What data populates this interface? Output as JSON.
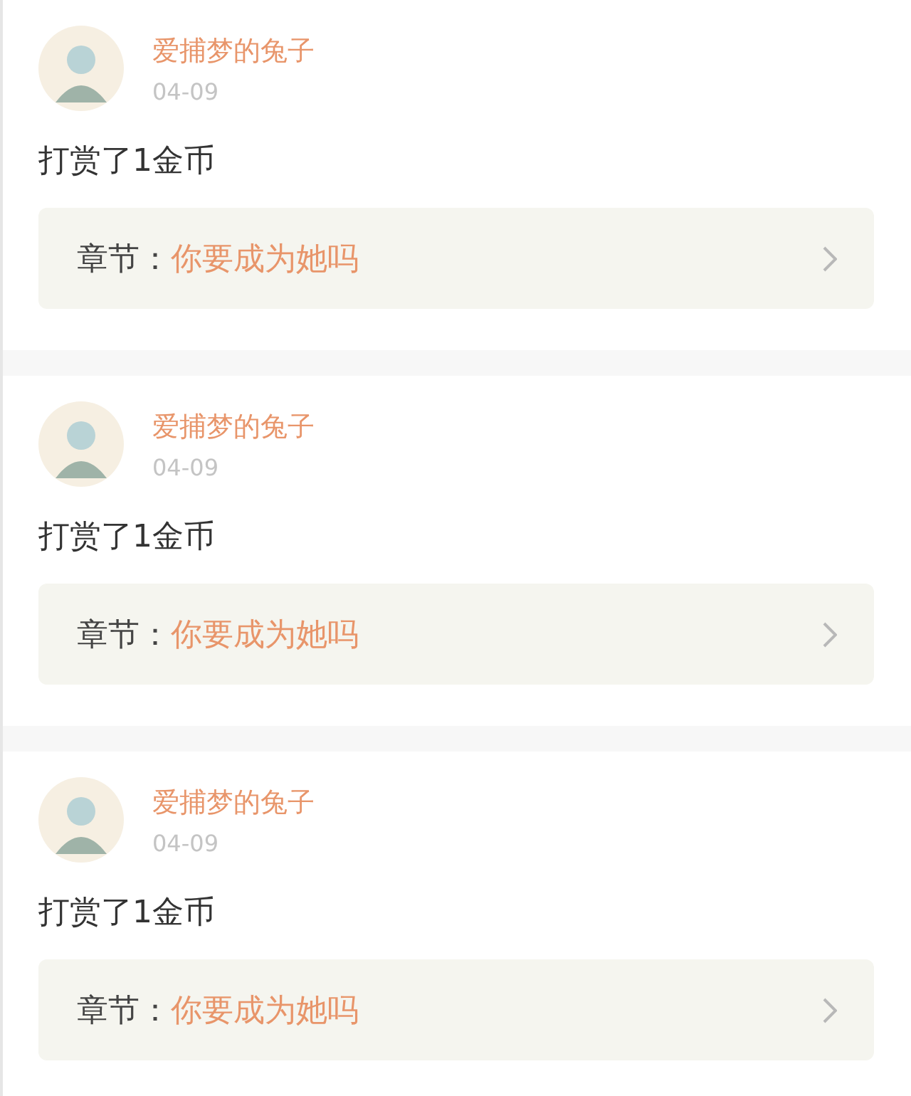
{
  "entries": [
    {
      "user": "爱捕梦的兔子",
      "date": "04-09",
      "action": "打赏了1金币",
      "chapter_label": "章节：",
      "chapter_title": "你要成为她吗"
    },
    {
      "user": "爱捕梦的兔子",
      "date": "04-09",
      "action": "打赏了1金币",
      "chapter_label": "章节：",
      "chapter_title": "你要成为她吗"
    },
    {
      "user": "爱捕梦的兔子",
      "date": "04-09",
      "action": "打赏了1金币",
      "chapter_label": "章节：",
      "chapter_title": "你要成为她吗"
    }
  ]
}
